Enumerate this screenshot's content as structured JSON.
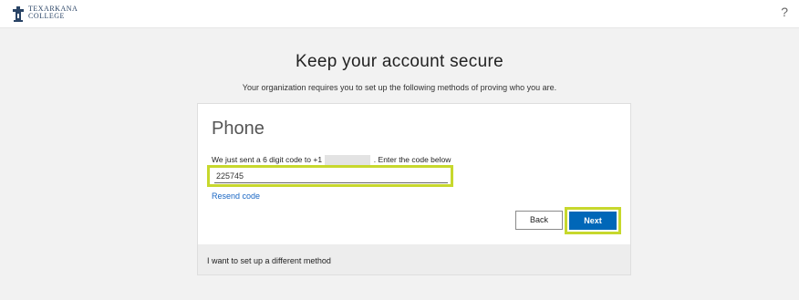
{
  "header": {
    "logo_line1": "TEXARKANA",
    "logo_line2": "COLLEGE",
    "help_glyph": "?"
  },
  "page": {
    "title": "Keep your account secure",
    "subtitle": "Your organization requires you to set up the following methods of proving who you are."
  },
  "card": {
    "title": "Phone",
    "instruction_before": "We just sent a 6 digit code to +1",
    "instruction_after": ". Enter the code below",
    "code_value": "225745",
    "resend_label": "Resend code",
    "back_label": "Back",
    "next_label": "Next",
    "footer_link": "I want to set up a different method"
  },
  "colors": {
    "highlight": "#c7d82d",
    "primary_button": "#0067b8",
    "link": "#1a67c4"
  },
  "icons": {
    "logo": "tower-emblem-icon",
    "help": "help-icon"
  }
}
